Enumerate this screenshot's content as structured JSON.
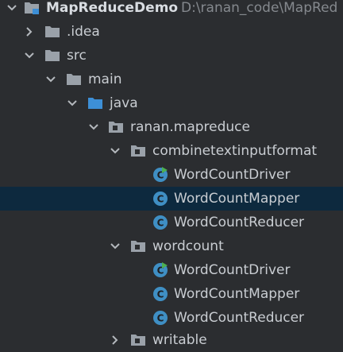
{
  "project": {
    "name": "MapReduceDemo",
    "path": "D:\\ranan_code\\MapRed"
  },
  "tree": [
    {
      "label": "MapReduceDemo",
      "path": "D:\\ranan_code\\MapRed",
      "icon": "module-folder-icon",
      "expanded": true,
      "level": 0
    },
    {
      "label": ".idea",
      "icon": "folder-icon",
      "expanded": false,
      "level": 1
    },
    {
      "label": "src",
      "icon": "folder-icon",
      "expanded": true,
      "level": 1
    },
    {
      "label": "main",
      "icon": "folder-icon",
      "expanded": true,
      "level": 2
    },
    {
      "label": "java",
      "icon": "source-root-folder-icon",
      "expanded": true,
      "level": 3
    },
    {
      "label": "ranan.mapreduce",
      "icon": "package-icon",
      "expanded": true,
      "level": 4
    },
    {
      "label": "combinetextinputformat",
      "icon": "package-icon",
      "expanded": true,
      "level": 5
    },
    {
      "label": "WordCountDriver",
      "icon": "runnable-class-icon",
      "level": 6
    },
    {
      "label": "WordCountMapper",
      "icon": "class-icon",
      "level": 6,
      "selected": true
    },
    {
      "label": "WordCountReducer",
      "icon": "class-icon",
      "level": 6
    },
    {
      "label": "wordcount",
      "icon": "package-icon",
      "expanded": true,
      "level": 5
    },
    {
      "label": "WordCountDriver",
      "icon": "runnable-class-icon",
      "level": 6
    },
    {
      "label": "WordCountMapper",
      "icon": "class-icon",
      "level": 6
    },
    {
      "label": "WordCountReducer",
      "icon": "class-icon",
      "level": 6
    },
    {
      "label": "writable",
      "icon": "package-icon",
      "expanded": false,
      "level": 5
    }
  ],
  "colors": {
    "background": "#2b2d30",
    "selection": "#0d293e",
    "text": "#c9cdd2",
    "folder": "#9aa1a9",
    "source_folder": "#3d8fd6",
    "class_icon": "#3f8fc4",
    "run_marker": "#4caf50"
  }
}
